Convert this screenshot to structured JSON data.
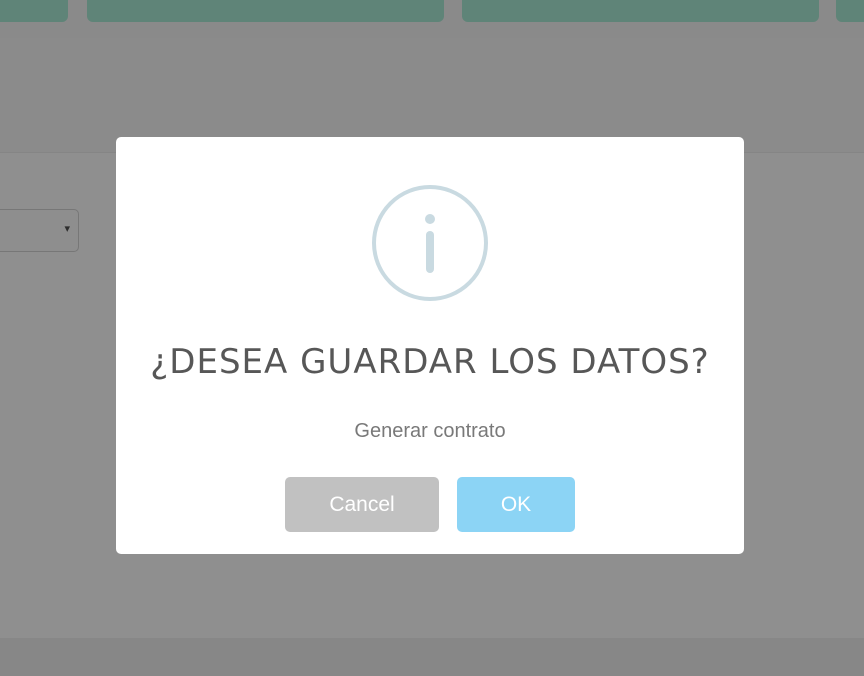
{
  "dialog": {
    "title": "¿DESEA GUARDAR LOS DATOS?",
    "text": "Generar contrato",
    "cancel_label": "Cancel",
    "ok_label": "OK",
    "icon": "info-icon"
  },
  "background": {
    "select_caret": "▾"
  },
  "colors": {
    "overlay_gray": "#8e8e8e",
    "tab_green": "#5f8478",
    "ok_button": "#8cd4f5",
    "cancel_button": "#c1c1c1",
    "icon_stroke": "#c9dae1",
    "title_text": "#575757",
    "body_text": "#797979"
  }
}
